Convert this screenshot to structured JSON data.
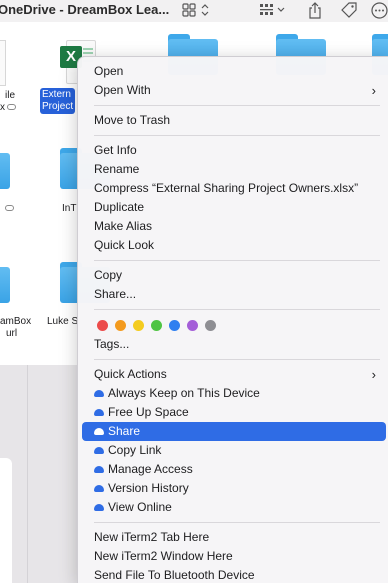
{
  "window": {
    "title": "OneDrive - DreamBox Lea..."
  },
  "files": {
    "selected_line1": "Extern",
    "selected_line2": "Project",
    "left_fragment1": "ile",
    "left_fragment2": "x",
    "middle_label": "InT",
    "left_bottom1": "amBox",
    "left_bottom2": "url",
    "luke_label": "Luke S"
  },
  "menu": {
    "group1": [
      {
        "label": "Open",
        "submenu": false
      },
      {
        "label": "Open With",
        "submenu": true
      }
    ],
    "group2": [
      {
        "label": "Move to Trash"
      }
    ],
    "group3": [
      {
        "label": "Get Info"
      },
      {
        "label": "Rename"
      },
      {
        "label": "Compress “External Sharing Project Owners.xlsx”"
      },
      {
        "label": "Duplicate"
      },
      {
        "label": "Make Alias"
      },
      {
        "label": "Quick Look"
      }
    ],
    "group4": [
      {
        "label": "Copy"
      },
      {
        "label": "Share..."
      }
    ],
    "tag_colors": [
      "#ec4b4b",
      "#f39a1e",
      "#f4cc1f",
      "#4fc443",
      "#2f7ff0",
      "#a45ed8",
      "#8e8e93"
    ],
    "tags_label": "Tags...",
    "quick_actions_label": "Quick Actions",
    "onedrive_items": [
      {
        "label": "Always Keep on This Device",
        "highlighted": false
      },
      {
        "label": "Free Up Space",
        "highlighted": false
      },
      {
        "label": "Share",
        "highlighted": true
      },
      {
        "label": "Copy Link",
        "highlighted": false
      },
      {
        "label": "Manage Access",
        "highlighted": false
      },
      {
        "label": "Version History",
        "highlighted": false
      },
      {
        "label": "View Online",
        "highlighted": false
      }
    ],
    "group7": [
      {
        "label": "New iTerm2 Tab Here"
      },
      {
        "label": "New iTerm2 Window Here"
      },
      {
        "label": "Send File To Bluetooth Device"
      }
    ]
  },
  "colors": {
    "accent": "#2f6ce5",
    "selection": "#2761d9",
    "folder": "#4ab1ee"
  }
}
